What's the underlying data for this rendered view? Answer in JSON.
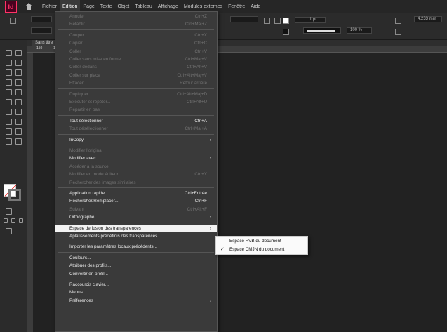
{
  "app": {
    "logo": "Id"
  },
  "menubar": {
    "items": [
      "Fichier",
      "Edition",
      "Page",
      "Texte",
      "Objet",
      "Tableau",
      "Affichage",
      "Modules externes",
      "Fenêtre",
      "Aide"
    ],
    "active": "Edition"
  },
  "control_panel": {
    "stroke_weight": "1 pt",
    "zoom": "100 %",
    "dimension": "4,233 mm"
  },
  "document": {
    "tab": "Sans titre",
    "ruler_ticks": [
      "150",
      "100"
    ]
  },
  "edit_menu": {
    "items": [
      {
        "label": "Annuler",
        "shortcut": "Ctrl+Z",
        "state": "disabled"
      },
      {
        "label": "Rétablir",
        "shortcut": "Ctrl+Maj+Z",
        "state": "disabled"
      },
      {
        "sep": true
      },
      {
        "label": "Couper",
        "shortcut": "Ctrl+X",
        "state": "disabled"
      },
      {
        "label": "Copier",
        "shortcut": "Ctrl+C",
        "state": "disabled"
      },
      {
        "label": "Coller",
        "shortcut": "Ctrl+V",
        "state": "disabled"
      },
      {
        "label": "Coller sans mise en forme",
        "shortcut": "Ctrl+Maj+V",
        "state": "disabled"
      },
      {
        "label": "Coller dedans",
        "shortcut": "Ctrl+Alt+V",
        "state": "disabled"
      },
      {
        "label": "Coller sur place",
        "shortcut": "Ctrl+Alt+Maj+V",
        "state": "disabled"
      },
      {
        "label": "Effacer",
        "shortcut": "Retour arrière",
        "state": "disabled"
      },
      {
        "sep": true
      },
      {
        "label": "Dupliquer",
        "shortcut": "Ctrl+Alt+Maj+D",
        "state": "disabled"
      },
      {
        "label": "Exécuter et répéter...",
        "shortcut": "Ctrl+Alt+U",
        "state": "disabled"
      },
      {
        "label": "Répartir en bas",
        "shortcut": "",
        "state": "disabled"
      },
      {
        "sep": true
      },
      {
        "label": "Tout sélectionner",
        "shortcut": "Ctrl+A",
        "state": "enabled"
      },
      {
        "label": "Tout désélectionner",
        "shortcut": "Ctrl+Maj+A",
        "state": "disabled"
      },
      {
        "sep": true
      },
      {
        "label": "InCopy",
        "shortcut": "",
        "state": "enabled",
        "submenu": true
      },
      {
        "sep": true
      },
      {
        "label": "Modifier l'original",
        "shortcut": "",
        "state": "disabled"
      },
      {
        "label": "Modifier avec",
        "shortcut": "",
        "state": "enabled",
        "submenu": true
      },
      {
        "label": "Accéder à la source",
        "shortcut": "",
        "state": "disabled"
      },
      {
        "label": "Modifier en mode éditeur",
        "shortcut": "Ctrl+Y",
        "state": "disabled"
      },
      {
        "label": "Rechercher des images similaires",
        "shortcut": "",
        "state": "disabled"
      },
      {
        "sep": true
      },
      {
        "label": "Application rapide...",
        "shortcut": "Ctrl+Entrée",
        "state": "enabled"
      },
      {
        "label": "Rechercher/Remplacer...",
        "shortcut": "Ctrl+F",
        "state": "enabled"
      },
      {
        "label": "Suivant",
        "shortcut": "Ctrl+Alt+F",
        "state": "disabled"
      },
      {
        "label": "Orthographe",
        "shortcut": "",
        "state": "enabled",
        "submenu": true
      },
      {
        "sep": true
      },
      {
        "label": "Espace de fusion des transparences",
        "shortcut": "",
        "state": "highlighted",
        "submenu": true
      },
      {
        "label": "Aplatissements prédéfinis des transparences...",
        "shortcut": "",
        "state": "enabled"
      },
      {
        "sep": true
      },
      {
        "label": "Importer les paramètres locaux précédents...",
        "shortcut": "",
        "state": "enabled"
      },
      {
        "sep": true
      },
      {
        "label": "Couleurs...",
        "shortcut": "",
        "state": "enabled"
      },
      {
        "label": "Attribuer des profils...",
        "shortcut": "",
        "state": "enabled"
      },
      {
        "label": "Convertir en profil...",
        "shortcut": "",
        "state": "enabled"
      },
      {
        "sep": true
      },
      {
        "label": "Raccourcis clavier...",
        "shortcut": "",
        "state": "enabled"
      },
      {
        "label": "Menus...",
        "shortcut": "",
        "state": "enabled"
      },
      {
        "label": "Préférences",
        "shortcut": "",
        "state": "enabled",
        "submenu": true
      }
    ]
  },
  "submenu": {
    "items": [
      {
        "label": "Espace RVB du document",
        "checked": false
      },
      {
        "label": "Espace CMJN du document",
        "checked": true
      }
    ]
  }
}
